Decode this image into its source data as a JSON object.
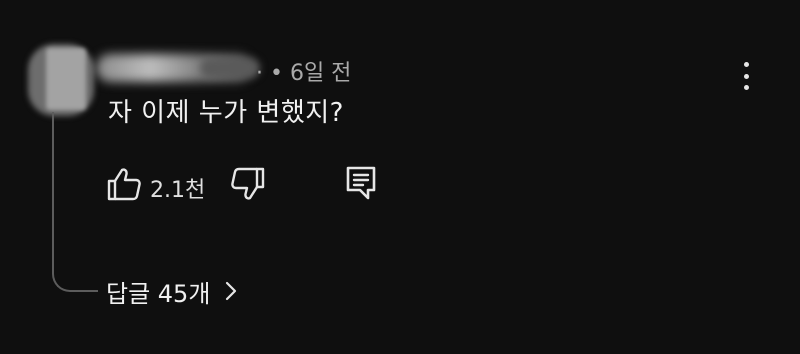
{
  "comment": {
    "time_meta": "· • 6일 전",
    "text": "자 이제 누가 변했지?",
    "likes": "2.1천",
    "replies_label": "답글 45개"
  },
  "icons": {
    "like": "thumbs-up-icon",
    "dislike": "thumbs-down-icon",
    "reply": "comment-reply-icon",
    "more": "more-vert-icon",
    "chevron": "chevron-right-icon"
  },
  "colors": {
    "background": "#0f0f0f",
    "text": "#f1f1f1",
    "secondary_text": "#aaaaaa",
    "thread_line": "#5c5c5c"
  }
}
